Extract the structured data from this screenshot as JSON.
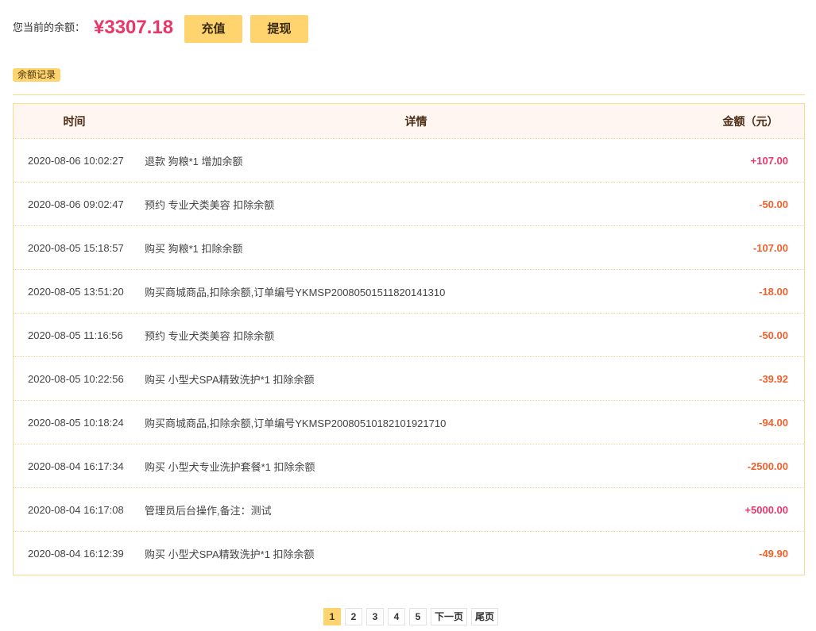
{
  "balance": {
    "label": "您当前的余额：",
    "amount": "¥3307.18",
    "recharge_label": "充值",
    "withdraw_label": "提现"
  },
  "tab": {
    "label": "余额记录"
  },
  "table": {
    "headers": {
      "time": "时间",
      "detail": "详情",
      "amount": "金额（元）"
    },
    "rows": [
      {
        "time": "2020-08-06 10:02:27",
        "detail": "退款 狗粮*1 增加余额",
        "amount": "+107.00"
      },
      {
        "time": "2020-08-06 09:02:47",
        "detail": "预约 专业犬类美容 扣除余额",
        "amount": "-50.00"
      },
      {
        "time": "2020-08-05 15:18:57",
        "detail": "购买 狗粮*1 扣除余额",
        "amount": "-107.00"
      },
      {
        "time": "2020-08-05 13:51:20",
        "detail": "购买商城商品,扣除余额,订单编号YKMSP20080501511820141310",
        "amount": "-18.00"
      },
      {
        "time": "2020-08-05 11:16:56",
        "detail": "预约 专业犬类美容 扣除余额",
        "amount": "-50.00"
      },
      {
        "time": "2020-08-05 10:22:56",
        "detail": "购买 小型犬SPA精致洗护*1 扣除余额",
        "amount": "-39.92"
      },
      {
        "time": "2020-08-05 10:18:24",
        "detail": "购买商城商品,扣除余额,订单编号YKMSP20080510182101921710",
        "amount": "-94.00"
      },
      {
        "time": "2020-08-04 16:17:34",
        "detail": "购买 小型犬专业洗护套餐*1 扣除余额",
        "amount": "-2500.00"
      },
      {
        "time": "2020-08-04 16:17:08",
        "detail": "管理员后台操作,备注：测试",
        "amount": "+5000.00"
      },
      {
        "time": "2020-08-04 16:12:39",
        "detail": "购买 小型犬SPA精致洗护*1 扣除余额",
        "amount": "-49.90"
      }
    ]
  },
  "pagination": {
    "pages": [
      "1",
      "2",
      "3",
      "4",
      "5"
    ],
    "current": "1",
    "next_label": "下一页",
    "last_label": "尾页"
  },
  "colors": {
    "accent": "#e8386a",
    "positive": "#e8386a",
    "negative": "#f0612c",
    "button": "#ffd46e",
    "divider": "#f3d98a",
    "table_header_bg": "#fff5f1"
  }
}
